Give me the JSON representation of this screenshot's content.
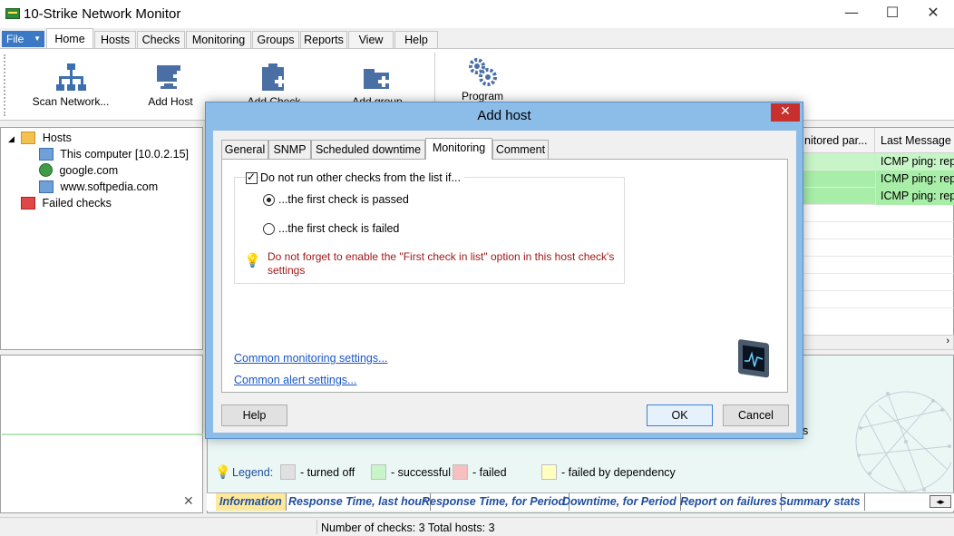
{
  "window": {
    "title": "10-Strike Network Monitor",
    "min_glyph": "—",
    "max_glyph": "☐",
    "close_glyph": "✕"
  },
  "menu": {
    "file": "File",
    "tabs": [
      "Home",
      "Hosts",
      "Checks",
      "Monitoring",
      "Groups",
      "Reports",
      "View",
      "Help"
    ]
  },
  "ribbon": {
    "scan": "Scan Network...",
    "add_host": "Add Host",
    "add_check": "Add Check",
    "add_group": "Add group",
    "program": "Program"
  },
  "tree": {
    "hosts": "Hosts",
    "items": [
      "This computer [10.0.2.15]",
      "google.com",
      "www.softpedia.com"
    ],
    "failed": "Failed checks"
  },
  "grid": {
    "col_partial": "nitored par...",
    "col_last": "Last Message",
    "rows": [
      "ICMP ping: repl",
      "ICMP ping: repl",
      "ICMP ping: repl"
    ]
  },
  "legend": {
    "title": "Legend:",
    "turned_off": "- turned off",
    "successful": "- successful",
    "failed": "- failed",
    "failed_dep": "- failed by dependency",
    "colors": {
      "turned_off": "#e0e0e0",
      "successful": "#c8f5c8",
      "failed": "#f7c0c0",
      "failed_dep": "#ffffc0"
    }
  },
  "bottom_tabs": [
    "Information",
    "Response Time, last hour",
    "Response Time, for Period",
    "Downtime, for Period",
    "Report on failures",
    "Summary stats"
  ],
  "status": "Number of checks: 3  Total hosts: 3",
  "dialog": {
    "title": "Add host",
    "tabs": [
      "General",
      "SNMP",
      "Scheduled downtime",
      "Monitoring",
      "Comment"
    ],
    "active_tab": "Monitoring",
    "checkbox_label": "Do not run other checks from the list if...",
    "radio_passed": "...the first check is passed",
    "radio_failed": "...the first check is failed",
    "hint": "Do not forget to enable the \"First check in list\" option in this host check's settings",
    "link_monitoring": "Common monitoring settings...",
    "link_alert": "Common alert settings...",
    "help_button": "Help",
    "ok_button": "OK",
    "cancel_button": "Cancel",
    "extra_char": "s"
  }
}
